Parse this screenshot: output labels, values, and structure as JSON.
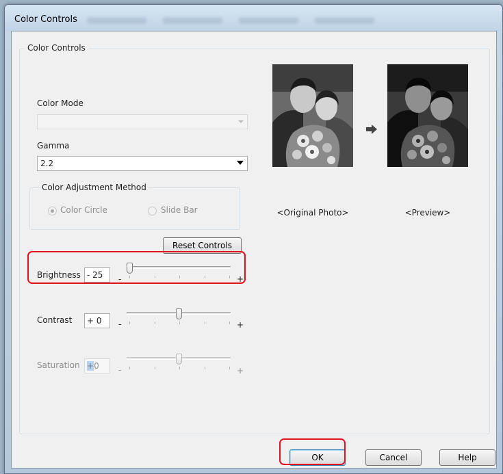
{
  "window": {
    "title": "Color Controls"
  },
  "group": {
    "label": "Color Controls"
  },
  "color_mode": {
    "label": "Color Mode",
    "value": "",
    "enabled": false
  },
  "gamma": {
    "label": "Gamma",
    "value": "2.2"
  },
  "adjustment_method": {
    "label": "Color Adjustment Method",
    "options": [
      "Color Circle",
      "Slide Bar"
    ],
    "selected": "Color Circle",
    "enabled": false
  },
  "reset_button": {
    "label": "Reset Controls"
  },
  "sliders": {
    "brightness": {
      "label": "Brightness",
      "value": "- 25",
      "level": 0.0,
      "minus": "-",
      "plus": "+"
    },
    "contrast": {
      "label": "Contrast",
      "value": "+ 0",
      "level": 0.5,
      "minus": "-",
      "plus": "+"
    },
    "saturation": {
      "label": "Saturation",
      "value_sign": "+",
      "value_num": "0",
      "level": 0.5,
      "minus": "-",
      "plus": "+",
      "enabled": false
    }
  },
  "preview": {
    "original_caption": "<Original Photo>",
    "preview_caption": "<Preview>",
    "arrow_icon": "arrow-right-icon"
  },
  "footer": {
    "ok_label": "OK",
    "cancel_label": "Cancel",
    "help_label": "Help"
  },
  "colors": {
    "highlight_red": "#e0101e",
    "disabled_text": "#8d8d8d",
    "dialog_bg": "#f0f0f0"
  }
}
